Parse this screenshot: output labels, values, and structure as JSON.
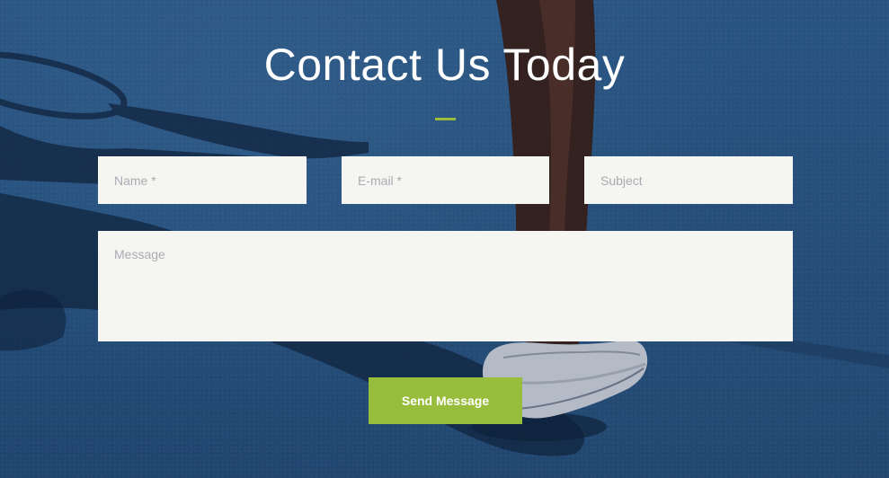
{
  "section": {
    "title": "Contact Us Today"
  },
  "form": {
    "name_placeholder": "Name *",
    "email_placeholder": "E-mail *",
    "subject_placeholder": "Subject",
    "message_placeholder": "Message",
    "submit_label": "Send Message"
  },
  "colors": {
    "accent": "#98bc3c",
    "field_bg": "#f5f5f2",
    "background": "#2f5f8f"
  }
}
